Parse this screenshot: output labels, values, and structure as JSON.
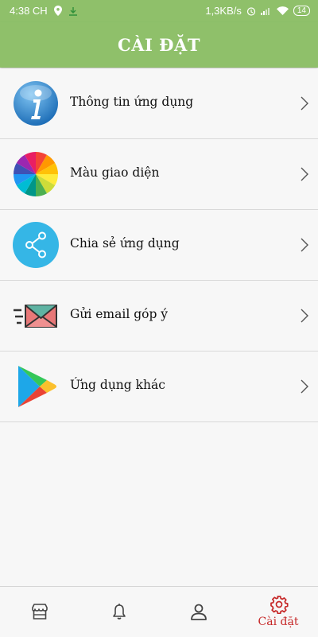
{
  "status_bar": {
    "time": "4:38 CH",
    "net_speed": "1,3KB/s",
    "battery": "14",
    "icons": [
      "location-icon",
      "download-icon",
      "alarm-icon",
      "signal-icon",
      "wifi-icon",
      "battery-icon"
    ]
  },
  "header": {
    "title": "CÀI ĐẶT"
  },
  "settings": {
    "items": [
      {
        "label": "Thông tin ứng dụng",
        "icon": "info-icon"
      },
      {
        "label": "Màu giao diện",
        "icon": "color-wheel-icon"
      },
      {
        "label": "Chia sẻ ứng dụng",
        "icon": "share-icon"
      },
      {
        "label": "Gửi email góp ý",
        "icon": "email-icon"
      },
      {
        "label": "Ứng dụng khác",
        "icon": "play-store-icon"
      }
    ]
  },
  "bottom_nav": {
    "items": [
      {
        "icon": "store-icon"
      },
      {
        "icon": "bell-icon"
      },
      {
        "icon": "user-icon"
      },
      {
        "icon": "settings-gear-icon",
        "label": "Cài đặt",
        "active": true
      }
    ]
  },
  "colors": {
    "primary": "#8fc06a",
    "active_nav": "#c62828",
    "background": "#f7f7f7"
  }
}
